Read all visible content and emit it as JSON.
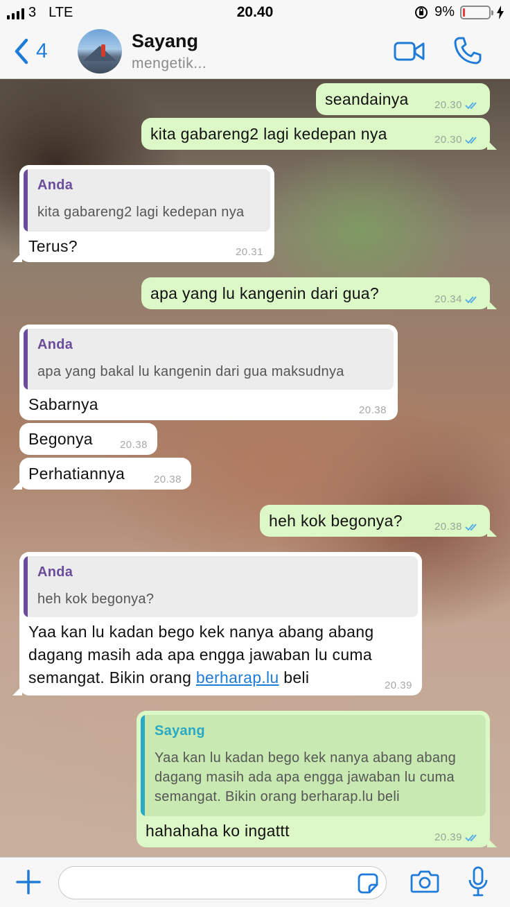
{
  "status_bar": {
    "carrier": "3",
    "network": "LTE",
    "time": "20.40",
    "battery_percent": "9%",
    "battery_level": 0.09
  },
  "header": {
    "back_count": "4",
    "contact_name": "Sayang",
    "contact_status": "mengetik...",
    "accent_color": "#1f7bd8"
  },
  "messages": [
    {
      "direction": "out",
      "text": "seandainya",
      "time": "20.30",
      "status": "read"
    },
    {
      "direction": "out",
      "text": "kita gabareng2 lagi kedepan nya",
      "time": "20.30",
      "status": "read"
    },
    {
      "direction": "in",
      "quote": {
        "author": "Anda",
        "text": "kita gabareng2 lagi kedepan nya"
      },
      "text": "Terus?",
      "time": "20.31"
    },
    {
      "direction": "out",
      "text": "apa yang lu kangenin dari gua?",
      "time": "20.34",
      "status": "read"
    },
    {
      "direction": "in",
      "quote": {
        "author": "Anda",
        "text": "apa yang bakal lu kangenin dari gua maksudnya"
      },
      "text": "Sabarnya",
      "time": "20.38"
    },
    {
      "direction": "in",
      "text": "Begonya",
      "time": "20.38"
    },
    {
      "direction": "in",
      "text": "Perhatiannya",
      "time": "20.38"
    },
    {
      "direction": "out",
      "text": "heh kok begonya?",
      "time": "20.38",
      "status": "read"
    },
    {
      "direction": "in",
      "quote": {
        "author": "Anda",
        "text": "heh kok begonya?"
      },
      "lines": [
        "Yaa kan lu kadan bego kek nanya abang abang",
        "dagang masih ada apa engga jawaban lu cuma",
        "semangat. Bikin orang "
      ],
      "link": "berharap.lu",
      "after_link": " beli",
      "time": "20.39"
    },
    {
      "direction": "out",
      "quote": {
        "author": "Sayang",
        "lines": [
          "Yaa kan lu kadan bego kek nanya abang abang",
          "dagang masih ada apa engga jawaban lu cuma",
          "semangat. Bikin orang berharap.lu beli"
        ]
      },
      "text": "hahahaha ko ingattt",
      "time": "20.39",
      "status": "read"
    }
  ],
  "input": {
    "placeholder": "",
    "value": ""
  },
  "icons": {
    "back": "chevron-left-icon",
    "video": "video-call-icon",
    "phone": "phone-icon",
    "add": "plus-icon",
    "sticker": "sticker-icon",
    "camera": "camera-icon",
    "mic": "microphone-icon",
    "read_receipt": "double-check-icon"
  }
}
